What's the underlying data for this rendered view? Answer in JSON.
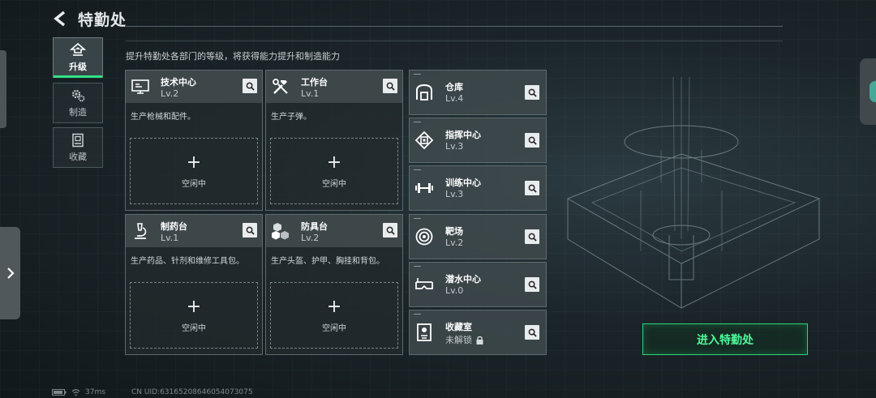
{
  "header": {
    "title": "特勤处",
    "subtitle": "提升特勤处各部门的等级，将获得能力提升和制造能力"
  },
  "side_tabs": [
    {
      "label": "升级",
      "icon": "upgrade-arrow-icon",
      "active": true
    },
    {
      "label": "制造",
      "icon": "gears-icon",
      "active": false
    },
    {
      "label": "收藏",
      "icon": "collection-case-icon",
      "active": false
    }
  ],
  "big_cards": [
    {
      "name": "技术中心",
      "level": "Lv.2",
      "desc": "生产枪械和配件。",
      "icon": "workstation-icon",
      "slot_label": "空闲中"
    },
    {
      "name": "工作台",
      "level": "Lv.1",
      "desc": "生产子弹。",
      "icon": "tools-icon",
      "slot_label": "空闲中"
    },
    {
      "name": "制药台",
      "level": "Lv.1",
      "desc": "生产药品、针剂和维修工具包。",
      "icon": "microscope-icon",
      "slot_label": "空闲中"
    },
    {
      "name": "防具台",
      "level": "Lv.2",
      "desc": "生产头盔、护甲、胸挂和背包。",
      "icon": "armor-cubes-icon",
      "slot_label": "空闲中"
    }
  ],
  "small_cards": [
    {
      "name": "仓库",
      "level": "Lv.4",
      "icon": "warehouse-icon"
    },
    {
      "name": "指挥中心",
      "level": "Lv.3",
      "icon": "command-chip-icon"
    },
    {
      "name": "训练中心",
      "level": "Lv.3",
      "icon": "dumbbell-icon"
    },
    {
      "name": "靶场",
      "level": "Lv.2",
      "icon": "target-icon"
    },
    {
      "name": "潜水中心",
      "level": "Lv.0",
      "icon": "diving-goggles-icon"
    },
    {
      "name": "收藏室",
      "level": "未解锁",
      "icon": "trophy-case-icon",
      "locked": true
    }
  ],
  "enter_button": {
    "label": "进入特勤处"
  },
  "footer": {
    "ping": "37ms",
    "uid": "CN UID:6316520864605407307­5"
  },
  "colors": {
    "accent": "#2fe38a",
    "enter_text": "#4dfa9c",
    "card_head": "#404a4e"
  }
}
